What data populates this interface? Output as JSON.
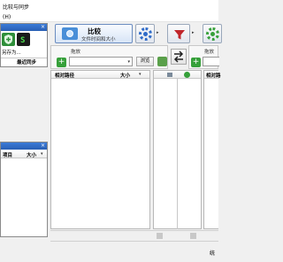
{
  "window": {
    "title": "比较与同步",
    "menu_partial": "(H)"
  },
  "left_panel_top": {
    "save_as_label": "另存为...",
    "tab_label": "最近同步"
  },
  "left_panel_bottom": {
    "col_item": "项目",
    "col_size": "大小"
  },
  "toolbar": {
    "compare_title": "比较",
    "compare_subtitle": "文件时间和大小"
  },
  "left_pane": {
    "drop_label": "拖放",
    "browse_label": "浏览",
    "col_path": "相对路径",
    "col_size": "大小"
  },
  "right_pane": {
    "drop_label": "拖放",
    "col_path": "相对路"
  },
  "status": {
    "right_text": "统"
  },
  "colors": {
    "panel_head": "#2f6bc8",
    "accent_green": "#36a03a",
    "filter_red": "#c0262b"
  }
}
